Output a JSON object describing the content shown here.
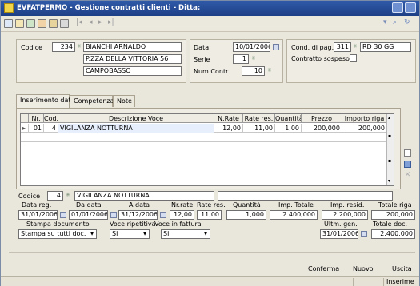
{
  "window": {
    "title": "EVFATPERMO - Gestione contratti clienti - Ditta:"
  },
  "header": {
    "codice_label": "Codice",
    "codice_value": "234",
    "client_name": "BIANCHI ARNALDO",
    "client_address": "P.ZZA DELLA VITTORIA 56",
    "client_city": "CAMPOBASSO",
    "data_label": "Data",
    "data_value": "10/01/2006",
    "serie_label": "Serie",
    "serie_value": "1",
    "numcontr_label": "Num.Contr.",
    "numcontr_value": "10",
    "condpag_label": "Cond. di pag.",
    "condpag_code": "311",
    "condpag_desc": "RD 30 GG",
    "contratto_sospeso_label": "Contratto sospeso"
  },
  "tabs": [
    "Inserimento dati",
    "Competenza",
    "Note"
  ],
  "grid": {
    "columns": [
      "Nr.",
      "Cod.",
      "Descrizione Voce",
      "N.Rate",
      "Rate res.",
      "Quantità",
      "Prezzo",
      "Importo riga"
    ],
    "rows": [
      {
        "nr": "01",
        "cod": "4",
        "descrizione": "VIGILANZA NOTTURNA",
        "nrate": "12,00",
        "rateres": "11,00",
        "quantita": "1,00",
        "prezzo": "200,000",
        "importo": "200,000"
      }
    ]
  },
  "detail": {
    "codice_label": "Codice",
    "codice_value": "4",
    "voce_desc": "VIGILANZA NOTTURNA",
    "labels": {
      "data_reg": "Data reg.",
      "da_data": "Da data",
      "a_data": "A data",
      "nrate": "Nr.rate",
      "rate_res": "Rate res.",
      "quantita": "Quantità",
      "imp_totale": "Imp. Totale",
      "imp_resid": "Imp. resid.",
      "totale_riga": "Totale riga",
      "stampa_documento": "Stampa documento",
      "voce_ripetitiva": "Voce ripetitiva",
      "voce_in_fattura": "Voce in fattura",
      "ultm_gen": "Ultm. gen.",
      "totale_doc": "Totale doc."
    },
    "values": {
      "data_reg": "31/01/2006",
      "da_data": "01/01/2006",
      "a_data": "31/12/2006",
      "nrate": "12,00",
      "rate_res": "11,00",
      "quantita": "1,000",
      "imp_totale": "2.400,000",
      "imp_resid": "2.200,000",
      "totale_riga": "200,000",
      "stampa_documento": "Stampa su tutti doc.",
      "voce_ripetitiva": "Si",
      "voce_in_fattura": "Si",
      "ultm_gen": "31/01/2006",
      "totale_doc": "2.400,000"
    }
  },
  "buttons": {
    "conferma": "Conferma",
    "nuovo": "Nuovo",
    "uscita": "Uscita"
  },
  "status": {
    "mode": "Inserime"
  }
}
